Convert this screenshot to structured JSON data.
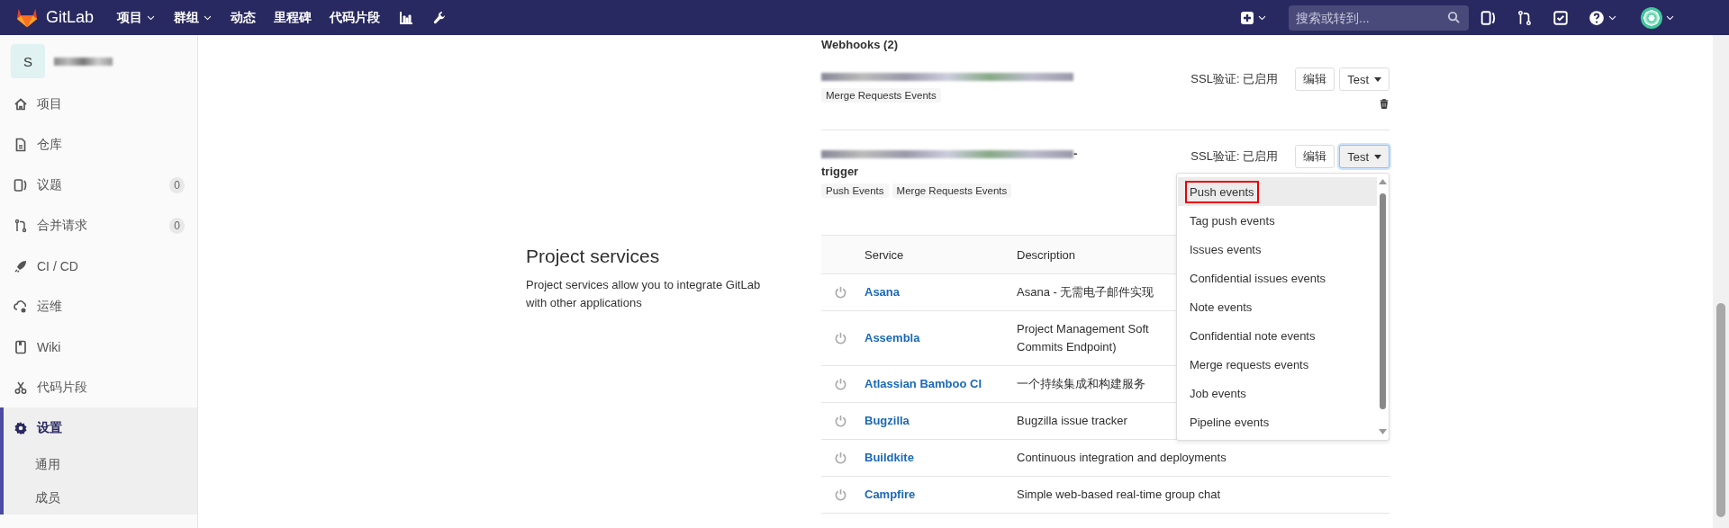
{
  "topbar": {
    "brand": "GitLab",
    "nav": [
      {
        "label": "项目",
        "dropdown": true
      },
      {
        "label": "群组",
        "dropdown": true
      },
      {
        "label": "动态",
        "dropdown": false
      },
      {
        "label": "里程碑",
        "dropdown": false
      },
      {
        "label": "代码片段",
        "dropdown": false
      }
    ],
    "search": {
      "placeholder": "搜索或转到..."
    }
  },
  "sidebar": {
    "project_avatar": "S",
    "items": [
      {
        "label": "项目",
        "selected": false
      },
      {
        "label": "仓库",
        "selected": false
      },
      {
        "label": "议题",
        "selected": false,
        "count": "0"
      },
      {
        "label": "合并请求",
        "selected": false,
        "count": "0"
      },
      {
        "label": "CI / CD",
        "selected": false
      },
      {
        "label": "运维",
        "selected": false
      },
      {
        "label": "Wiki",
        "selected": false
      },
      {
        "label": "代码片段",
        "selected": false
      },
      {
        "label": "设置",
        "selected": true,
        "children": [
          {
            "label": "通用",
            "selected": false
          },
          {
            "label": "成员",
            "selected": false
          }
        ]
      }
    ]
  },
  "webhooks": {
    "title": "Webhooks (2)",
    "hooks": [
      {
        "tags": [
          "Merge Requests Events"
        ],
        "ssl": "SSL验证: 已启用",
        "edit": "编辑",
        "test": "Test",
        "focused": false
      },
      {
        "url_end": "-",
        "url_line2": "trigger",
        "tags": [
          "Push Events",
          "Merge Requests Events"
        ],
        "ssl": "SSL验证: 已启用",
        "edit": "编辑",
        "test": "Test",
        "focused": true
      }
    ]
  },
  "test_menu": {
    "items": [
      {
        "label": "Push events",
        "selected": true,
        "outlined": true
      },
      {
        "label": "Tag push events",
        "selected": false,
        "outlined": false
      },
      {
        "label": "Issues events",
        "selected": false,
        "outlined": false
      },
      {
        "label": "Confidential issues events",
        "selected": false,
        "outlined": false
      },
      {
        "label": "Note events",
        "selected": false,
        "outlined": false
      },
      {
        "label": "Confidential note events",
        "selected": false,
        "outlined": false
      },
      {
        "label": "Merge requests events",
        "selected": false,
        "outlined": false
      },
      {
        "label": "Job events",
        "selected": false,
        "outlined": false
      },
      {
        "label": "Pipeline events",
        "selected": false,
        "outlined": false
      }
    ]
  },
  "services": {
    "title": "Project services",
    "description": "Project services allow you to integrate GitLab with other applications",
    "columns": [
      "Service",
      "Description"
    ],
    "rows": [
      {
        "name": "Asana",
        "description": "Asana - 无需电子邮件实现",
        "active": false
      },
      {
        "name": "Assembla",
        "description": "Project Management Soft\nCommits Endpoint)",
        "active": false
      },
      {
        "name": "Atlassian Bamboo CI",
        "description": "一个持续集成和构建服务",
        "active": false
      },
      {
        "name": "Bugzilla",
        "description": "Bugzilla issue tracker",
        "active": false
      },
      {
        "name": "Buildkite",
        "description": "Continuous integration and deployments",
        "active": false
      },
      {
        "name": "Campfire",
        "description": "Simple web-based real-time group chat",
        "active": false
      }
    ]
  }
}
